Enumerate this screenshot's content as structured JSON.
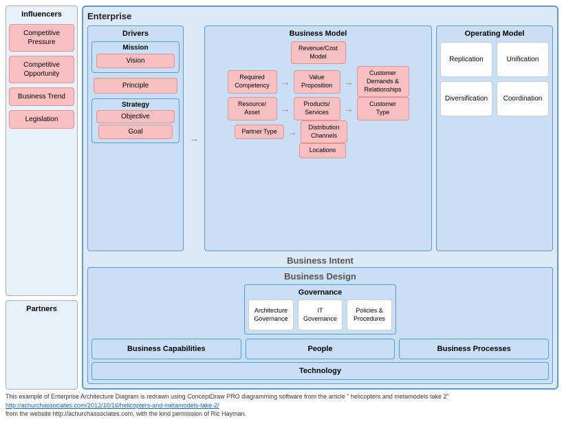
{
  "enterprise": {
    "title": "Enterprise",
    "businessIntent": "Business Intent",
    "businessDesign": "Business Design"
  },
  "influencers": {
    "title": "Influencers",
    "items": [
      {
        "label": "Competitive\nPressure"
      },
      {
        "label": "Competitive\nOpportunity"
      },
      {
        "label": "Business Trend"
      },
      {
        "label": "Legislation"
      }
    ]
  },
  "partners": {
    "title": "Partners"
  },
  "drivers": {
    "title": "Drivers",
    "mission": "Mission",
    "vision": "Vision",
    "principle": "Principle",
    "strategy": "Strategy",
    "objective": "Objective",
    "goal": "Goal"
  },
  "businessModel": {
    "title": "Business Model",
    "items": {
      "revenueCostModel": "Revenue/Cost\nModel",
      "requiredCompetency": "Required\nCompetency",
      "valueProposition": "Value\nProposition",
      "customerDemands": "Customer\nDemands &\nRelationships",
      "resourceAsset": "Resource/\nAsset",
      "productsServices": "Products/\nServices",
      "customerType": "Customer\nType",
      "partnerType": "Partner Type",
      "distributionChannels": "Distribution\nChannels",
      "locations": "Locations"
    }
  },
  "operatingModel": {
    "title": "Operating Model",
    "items": [
      {
        "label": "Replication"
      },
      {
        "label": "Unification"
      },
      {
        "label": "Diversification"
      },
      {
        "label": "Coordination"
      }
    ]
  },
  "governance": {
    "title": "Governance",
    "items": [
      {
        "label": "Architecture\nGovernance"
      },
      {
        "label": "IT Governance"
      },
      {
        "label": "Policies &\nProcedures"
      }
    ]
  },
  "bottom": {
    "capabilities": "Business Capabilities",
    "people": "People",
    "processes": "Business Processes",
    "technology": "Technology"
  },
  "footer": {
    "text1": "This example of Enterprise Architecture Diagram is redrawn using ConceptDraw PRO diagramming software from the article \" helicopters and metamodels take 2\"",
    "link": "http://achurchassociates.com/2012/10/16/helicopters-and-metamodels-take-2/",
    "text2": "from the website http://achurchassociates.com,  with the kind permission of Ric Hayman."
  }
}
